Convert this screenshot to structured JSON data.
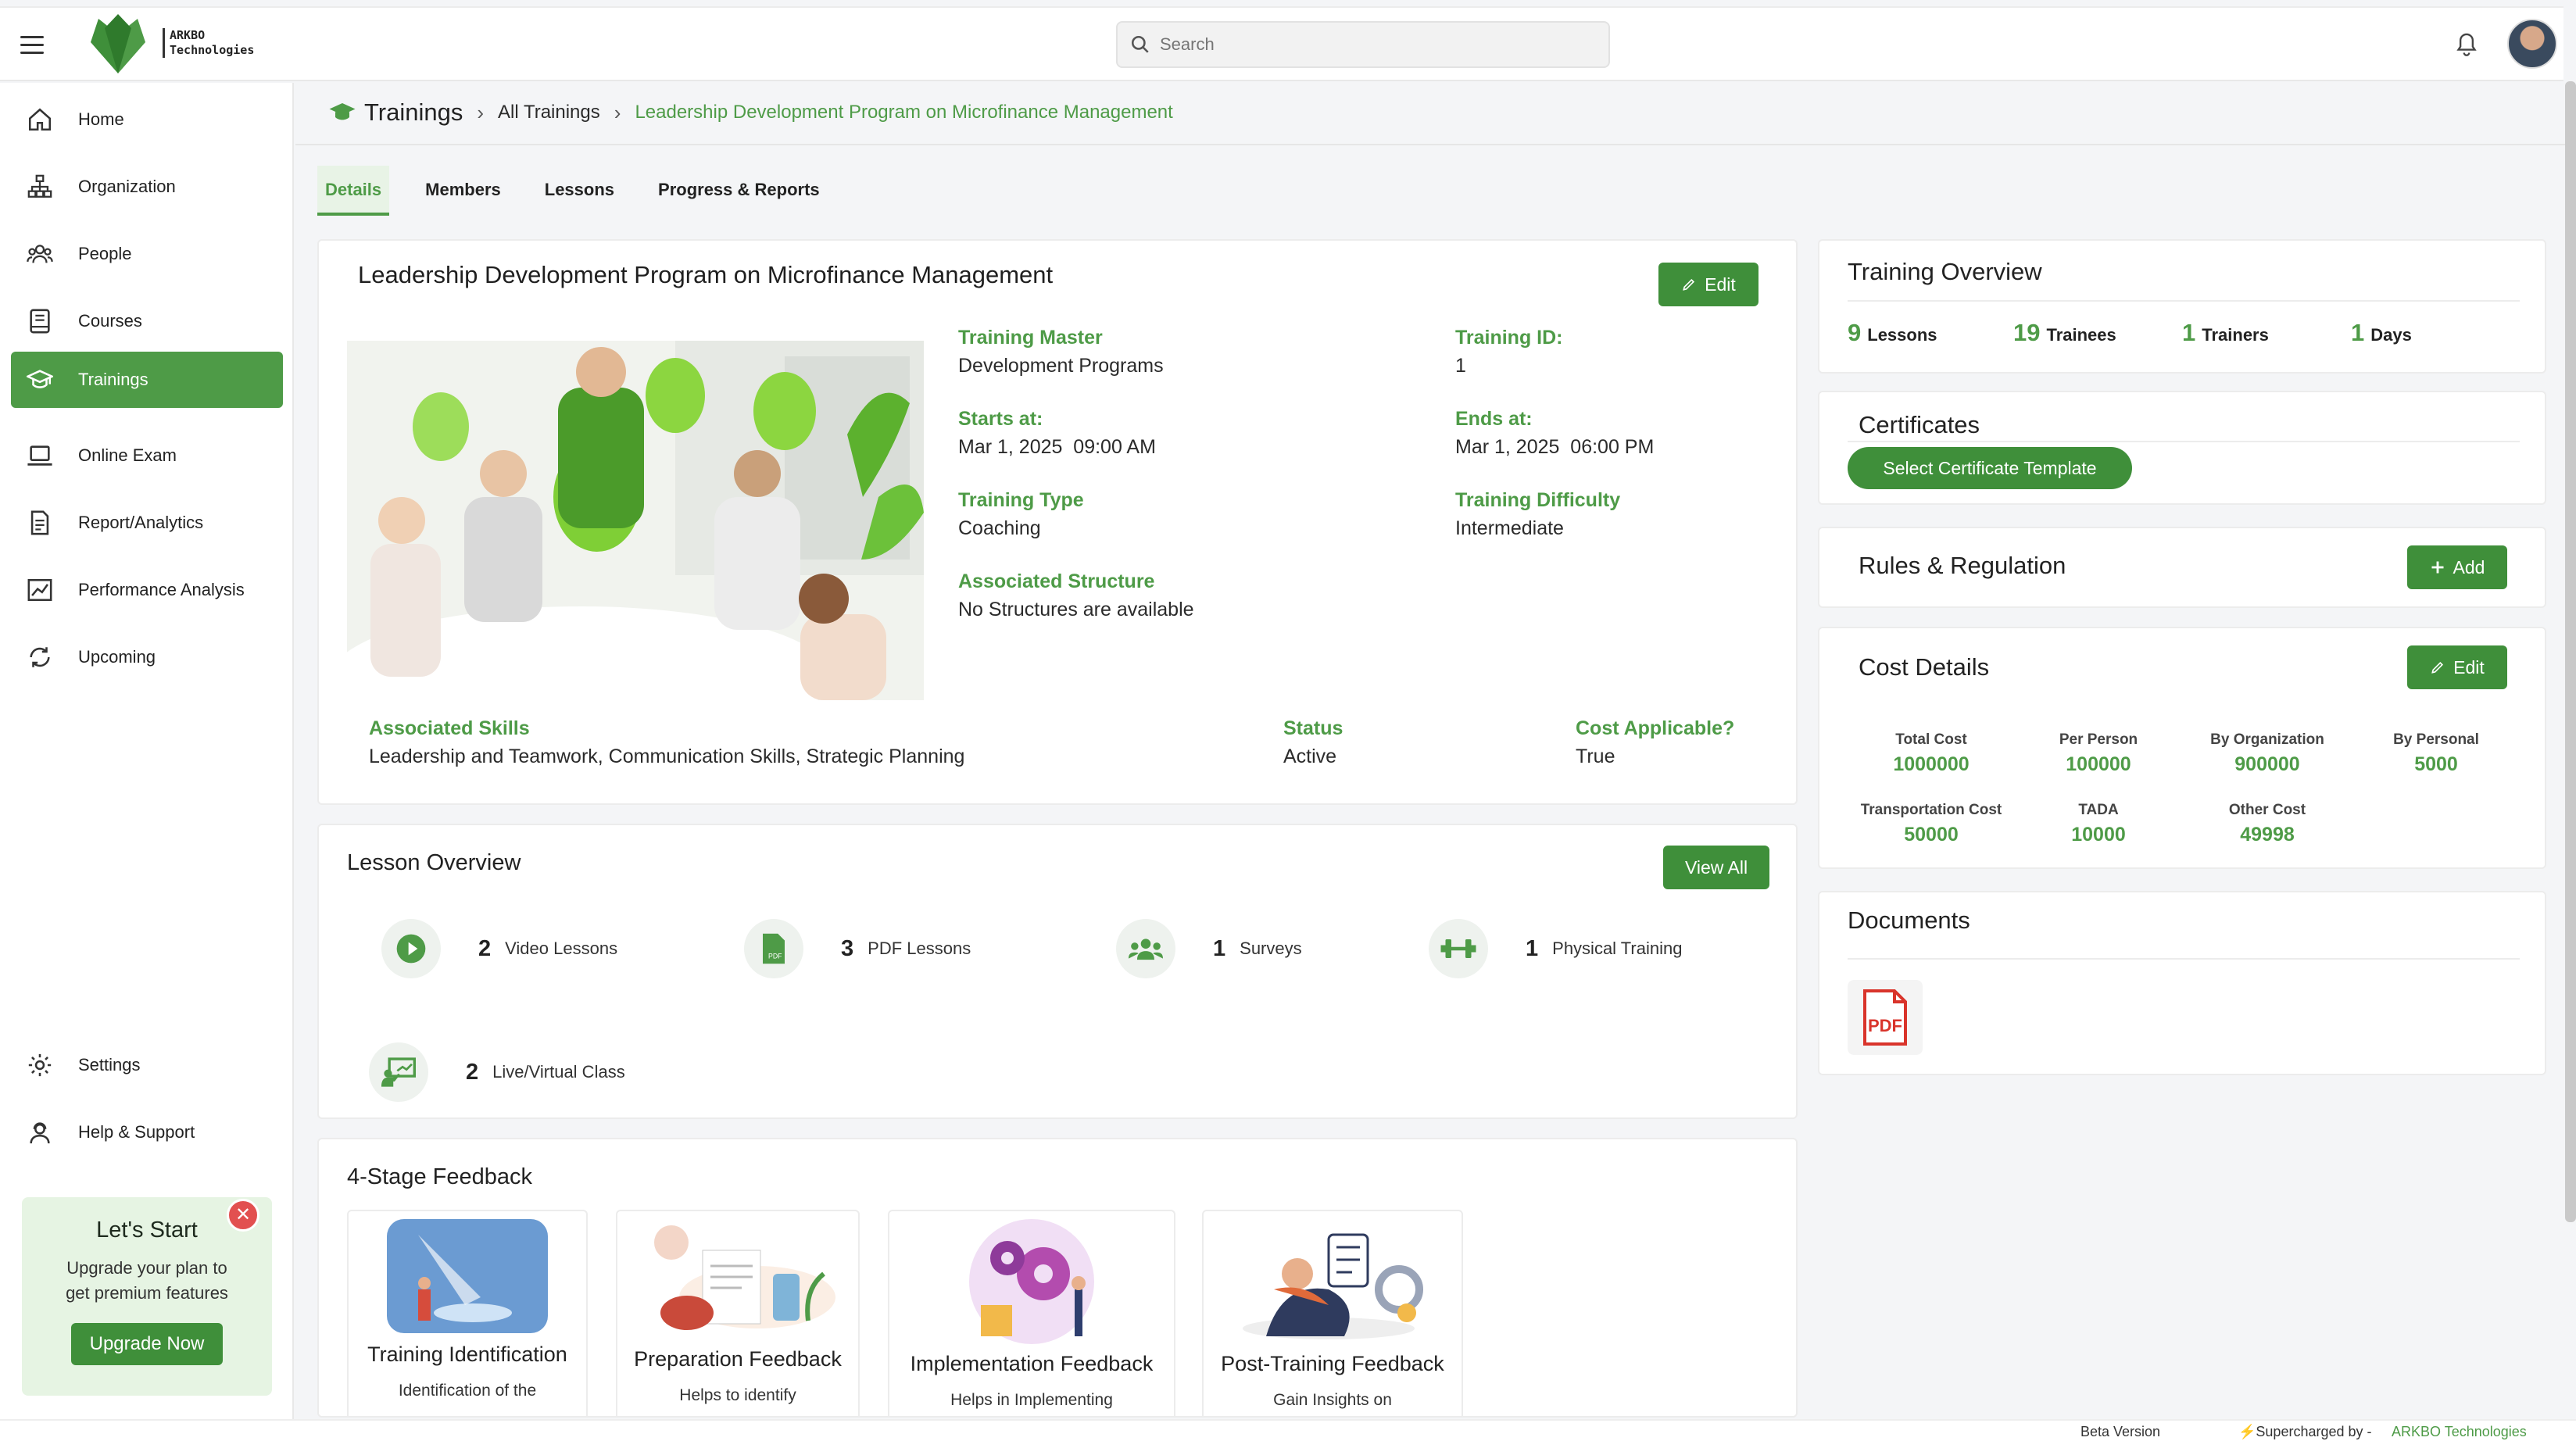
{
  "header": {
    "brand_line1": "ARKBO",
    "brand_line2": "Technologies",
    "search_placeholder": "Search"
  },
  "sidebar": {
    "items": [
      {
        "label": "Home",
        "icon": "home-icon"
      },
      {
        "label": "Organization",
        "icon": "org-chart-icon"
      },
      {
        "label": "People",
        "icon": "people-icon"
      },
      {
        "label": "Courses",
        "icon": "book-icon"
      },
      {
        "label": "Trainings",
        "icon": "graduation-cap-icon",
        "active": true
      },
      {
        "label": "Online Exam",
        "icon": "laptop-icon"
      },
      {
        "label": "Report/Analytics",
        "icon": "report-icon"
      },
      {
        "label": "Performance Analysis",
        "icon": "chart-icon"
      },
      {
        "label": "Upcoming",
        "icon": "refresh-icon"
      }
    ],
    "bottom": [
      {
        "label": "Settings",
        "icon": "gear-icon"
      },
      {
        "label": "Help & Support",
        "icon": "support-icon"
      }
    ],
    "promo": {
      "title": "Let's Start",
      "text1": "Upgrade your plan to",
      "text2": "get premium features",
      "button": "Upgrade Now"
    }
  },
  "breadcrumb": {
    "root": "Trainings",
    "mid": "All Trainings",
    "current": "Leadership Development Program on Microfinance Management"
  },
  "tabs": [
    "Details",
    "Members",
    "Lessons",
    "Progress & Reports"
  ],
  "training": {
    "title": "Leadership Development Program on Microfinance Management",
    "edit": "Edit",
    "fields": {
      "master_label": "Training Master",
      "master": "Development Programs",
      "id_label": "Training ID:",
      "id": "1",
      "starts_label": "Starts at:",
      "starts": "Mar 1, 2025  09:00 AM",
      "ends_label": "Ends at:",
      "ends": "Mar 1, 2025  06:00 PM",
      "type_label": "Training Type",
      "type": "Coaching",
      "difficulty_label": "Training Difficulty",
      "difficulty": "Intermediate",
      "structure_label": "Associated Structure",
      "structure": "No Structures are available",
      "skills_label": "Associated Skills",
      "skills": "Leadership and Teamwork, Communication Skills, Strategic Planning",
      "status_label": "Status",
      "status": "Active",
      "cost_label": "Cost Applicable?",
      "cost": "True"
    }
  },
  "lesson_overview": {
    "title": "Lesson Overview",
    "view_all": "View All",
    "items": [
      {
        "count": "2",
        "label": "Video Lessons",
        "icon": "play-icon"
      },
      {
        "count": "3",
        "label": "PDF Lessons",
        "icon": "pdf-file-icon"
      },
      {
        "count": "1",
        "label": "Surveys",
        "icon": "group-icon"
      },
      {
        "count": "1",
        "label": "Physical Training",
        "icon": "dumbbell-icon"
      },
      {
        "count": "2",
        "label": "Live/Virtual Class",
        "icon": "presentation-icon"
      }
    ]
  },
  "feedback": {
    "title": "4-Stage Feedback",
    "items": [
      {
        "title": "Training Identification",
        "sub": "Identification of the"
      },
      {
        "title": "Preparation Feedback",
        "sub": "Helps to identify"
      },
      {
        "title": "Implementation Feedback",
        "sub": "Helps in Implementing"
      },
      {
        "title": "Post-Training Feedback",
        "sub": "Gain Insights on"
      }
    ]
  },
  "overview": {
    "title": "Training Overview",
    "stats": [
      {
        "n": "9",
        "label": "Lessons"
      },
      {
        "n": "19",
        "label": "Trainees"
      },
      {
        "n": "1",
        "label": "Trainers"
      },
      {
        "n": "1",
        "label": "Days"
      }
    ]
  },
  "certificates": {
    "title": "Certificates",
    "button": "Select Certificate Template"
  },
  "rules": {
    "title": "Rules & Regulation",
    "button": "Add"
  },
  "cost": {
    "title": "Cost Details",
    "edit": "Edit",
    "items": [
      {
        "k": "Total Cost",
        "v": "1000000"
      },
      {
        "k": "Per Person",
        "v": "100000"
      },
      {
        "k": "By Organization",
        "v": "900000"
      },
      {
        "k": "By Personal",
        "v": "5000"
      },
      {
        "k": "Transportation Cost",
        "v": "50000"
      },
      {
        "k": "TADA",
        "v": "10000"
      },
      {
        "k": "Other Cost",
        "v": "49998"
      }
    ]
  },
  "documents": {
    "title": "Documents",
    "file_label": "PDF"
  },
  "footer": {
    "beta": "Beta Version",
    "powered": "⚡Supercharged by - ",
    "company": "ARKBO Technologies"
  },
  "colors": {
    "accent": "#4e9b47",
    "button": "#3f8f3a",
    "danger": "#e25050"
  }
}
